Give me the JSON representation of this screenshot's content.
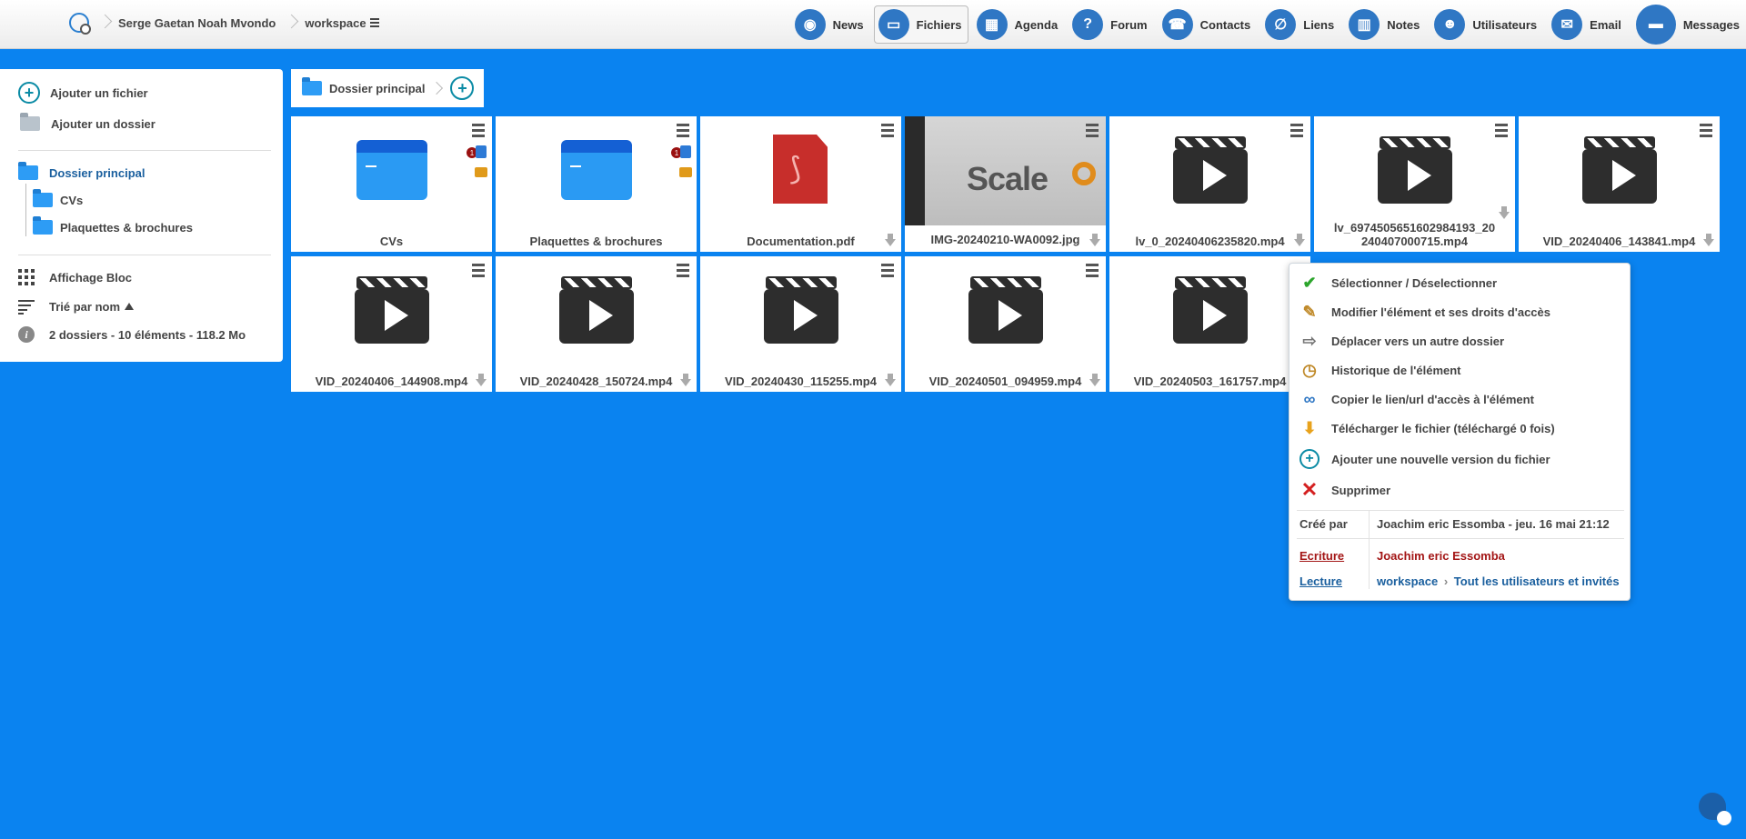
{
  "header": {
    "user": "Serge Gaetan Noah Mvondo",
    "space": "workspace",
    "nav": [
      {
        "label": "News",
        "icon": "rss-icon"
      },
      {
        "label": "Fichiers",
        "icon": "folder-icon",
        "active": true
      },
      {
        "label": "Agenda",
        "icon": "calendar-icon"
      },
      {
        "label": "Forum",
        "icon": "forum-icon"
      },
      {
        "label": "Contacts",
        "icon": "phone-icon"
      },
      {
        "label": "Liens",
        "icon": "paperclip-icon"
      },
      {
        "label": "Notes",
        "icon": "chart-icon"
      },
      {
        "label": "Utilisateurs",
        "icon": "users-icon"
      },
      {
        "label": "Email",
        "icon": "mail-icon"
      },
      {
        "label": "Messages",
        "icon": "chat-icon"
      }
    ]
  },
  "sidebar": {
    "add_file": "Ajouter un fichier",
    "add_folder": "Ajouter un dossier",
    "root_folder": "Dossier principal",
    "subfolders": [
      "CVs",
      "Plaquettes & brochures"
    ],
    "display_mode": "Affichage Bloc",
    "sort": "Trié par nom",
    "summary": "2 dossiers - 10 éléments - 118.2 Mo"
  },
  "pathbar": {
    "current": "Dossier principal"
  },
  "items": [
    {
      "name": "CVs",
      "kind": "folder",
      "likes": "1"
    },
    {
      "name": "Plaquettes & brochures",
      "kind": "folder",
      "likes": "1"
    },
    {
      "name": "Documentation.pdf",
      "kind": "pdf"
    },
    {
      "name": "IMG-20240210-WA0092.jpg",
      "kind": "image",
      "thumb_text": "Scale"
    },
    {
      "name": "lv_0_20240406235820.mp4",
      "kind": "video"
    },
    {
      "name": "lv_6974505651602984193_20240407000715.mp4",
      "kind": "video"
    },
    {
      "name": "VID_20240406_143841.mp4",
      "kind": "video"
    },
    {
      "name": "VID_20240406_144908.mp4",
      "kind": "video"
    },
    {
      "name": "VID_20240428_150724.mp4",
      "kind": "video"
    },
    {
      "name": "VID_20240430_115255.mp4",
      "kind": "video"
    },
    {
      "name": "VID_20240501_094959.mp4",
      "kind": "video"
    },
    {
      "name": "VID_20240503_161757.mp4",
      "kind": "video"
    }
  ],
  "context_menu": {
    "items": [
      "Sélectionner / Déselectionner",
      "Modifier l'élément et ses droits d'accès",
      "Déplacer vers un autre dossier",
      "Historique de l'élément",
      "Copier le lien/url d'accès à l'élément",
      "Télécharger le fichier  (téléchargé 0 fois)",
      "Ajouter une nouvelle version du fichier",
      "Supprimer"
    ],
    "created_by_label": "Créé par",
    "created_by_value": "Joachim eric Essomba - jeu. 16 mai 21:12",
    "write_label": "Ecriture",
    "write_value": "Joachim eric Essomba",
    "read_label": "Lecture",
    "read_space": "workspace",
    "read_value": "Tout les utilisateurs et invités"
  },
  "colors": {
    "background": "#0a83f0",
    "accent": "#1a5f9e",
    "danger": "#a31515"
  }
}
